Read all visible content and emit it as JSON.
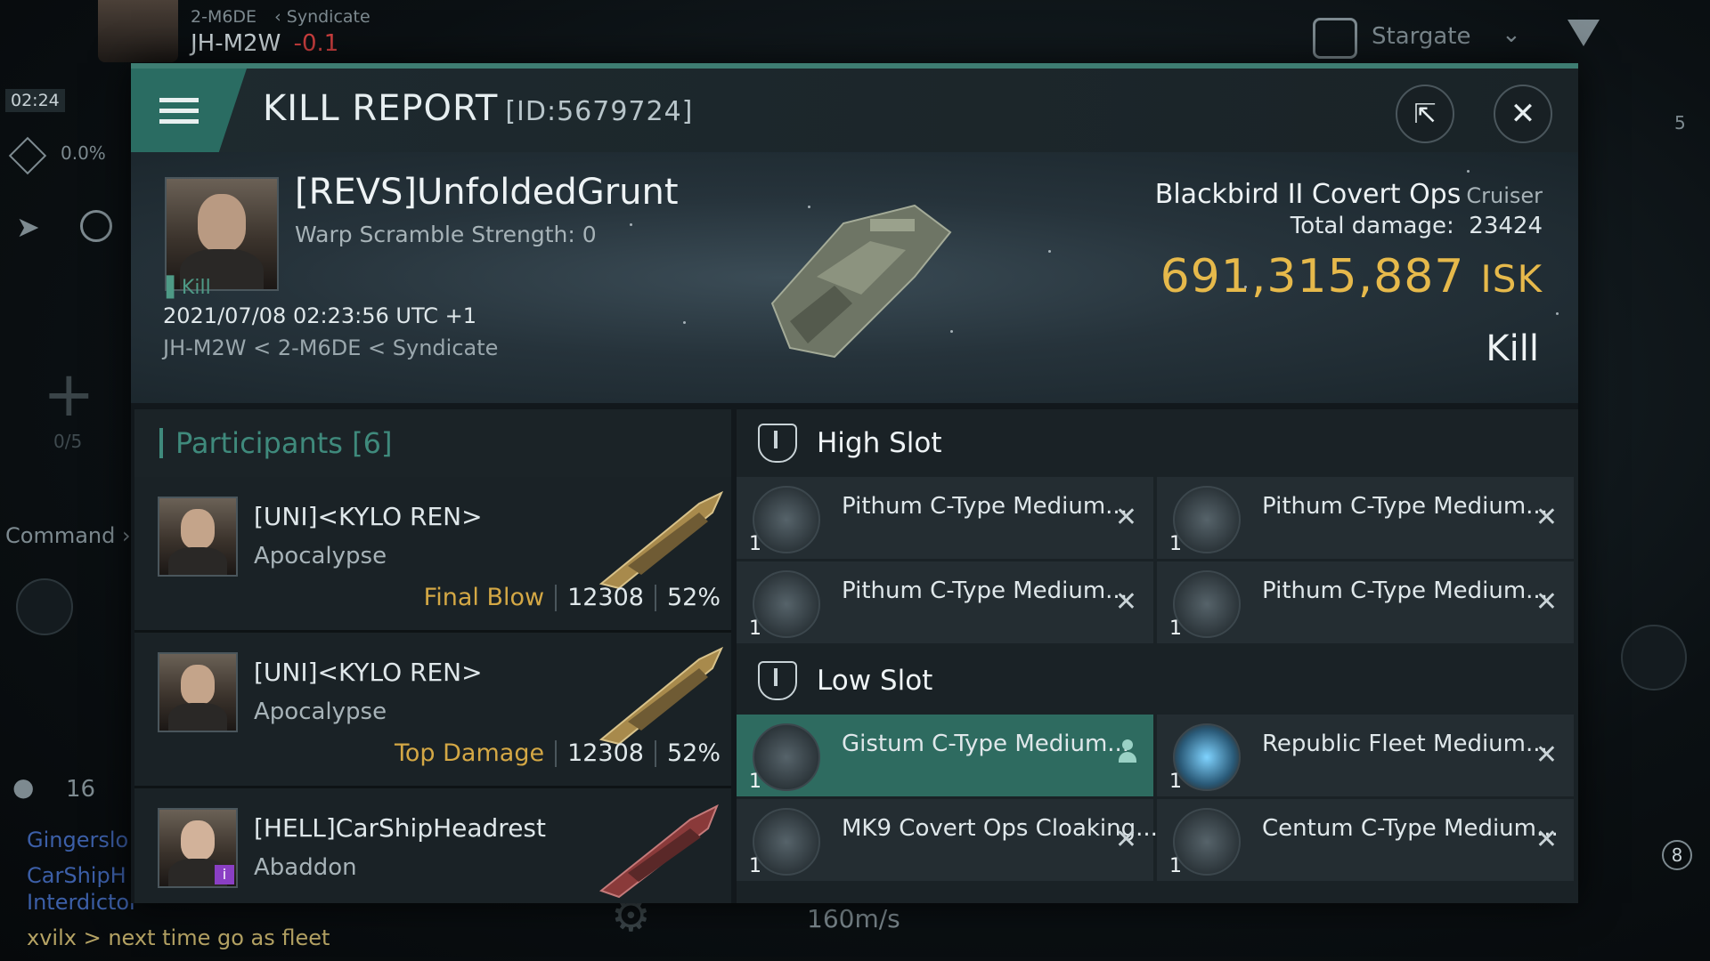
{
  "hud": {
    "system_path": "2-M6DE",
    "region": "Syndicate",
    "system": "JH-M2W",
    "security": "-0.1",
    "time": "02:24",
    "cargo_pct": "0.0%",
    "fleet_slots": "0/5",
    "command_label": "Command",
    "local_count": "16",
    "stargate_label": "Stargate",
    "speed": "160m/s",
    "right_badge": "5",
    "drone_badge": "8",
    "chat": [
      {
        "name": "Gingerslo"
      },
      {
        "name": "CarShipH"
      },
      {
        "name": "Interdictor"
      }
    ],
    "chat_message": "xvilx > next time go as fleet"
  },
  "modal": {
    "title": "KILL REPORT",
    "id": "[ID:5679724]",
    "share_icon": "share-icon",
    "close_icon": "close-icon"
  },
  "victim": {
    "name": "[REVS]UnfoldedGrunt",
    "warp_scramble": "Warp Scramble Strength: 0",
    "tag": "Kill",
    "date": "2021/07/08 02:23:56 UTC +1",
    "location": "JH-M2W < 2-M6DE < Syndicate",
    "ship": "Blackbird II Covert Ops",
    "ship_class": "Cruiser",
    "total_damage_label": "Total damage:",
    "total_damage": "23424",
    "isk_value": "691,315,887",
    "isk_unit": "ISK",
    "result": "Kill"
  },
  "participants": {
    "header": "Participants [6]",
    "rows": [
      {
        "name": "[UNI]<KYLO REN>",
        "ship": "Apocalypse",
        "label": "Final Blow",
        "damage": "12308",
        "pct": "52%"
      },
      {
        "name": "[UNI]<KYLO REN>",
        "ship": "Apocalypse",
        "label": "Top Damage",
        "damage": "12308",
        "pct": "52%"
      },
      {
        "name": "[HELL]CarShipHeadrest",
        "ship": "Abaddon",
        "label": "",
        "damage": "",
        "pct": ""
      }
    ]
  },
  "slots": {
    "high": {
      "label": "High Slot",
      "modules": [
        {
          "name": "Pithum C-Type Medium...",
          "qty": "1"
        },
        {
          "name": "Pithum C-Type Medium...",
          "qty": "1"
        },
        {
          "name": "Pithum C-Type Medium...",
          "qty": "1"
        },
        {
          "name": "Pithum C-Type Medium...",
          "qty": "1"
        }
      ]
    },
    "low": {
      "label": "Low Slot",
      "modules": [
        {
          "name": "Gistum C-Type Medium...",
          "qty": "1"
        },
        {
          "name": "Republic Fleet Medium...",
          "qty": "1"
        },
        {
          "name": "MK9 Covert Ops Cloaking...",
          "qty": "1"
        },
        {
          "name": "Centum C-Type Medium...",
          "qty": "1"
        }
      ]
    }
  },
  "colors": {
    "accent": "#3e7d72",
    "isk": "#e6b94b",
    "final_blow": "#d4a845"
  }
}
